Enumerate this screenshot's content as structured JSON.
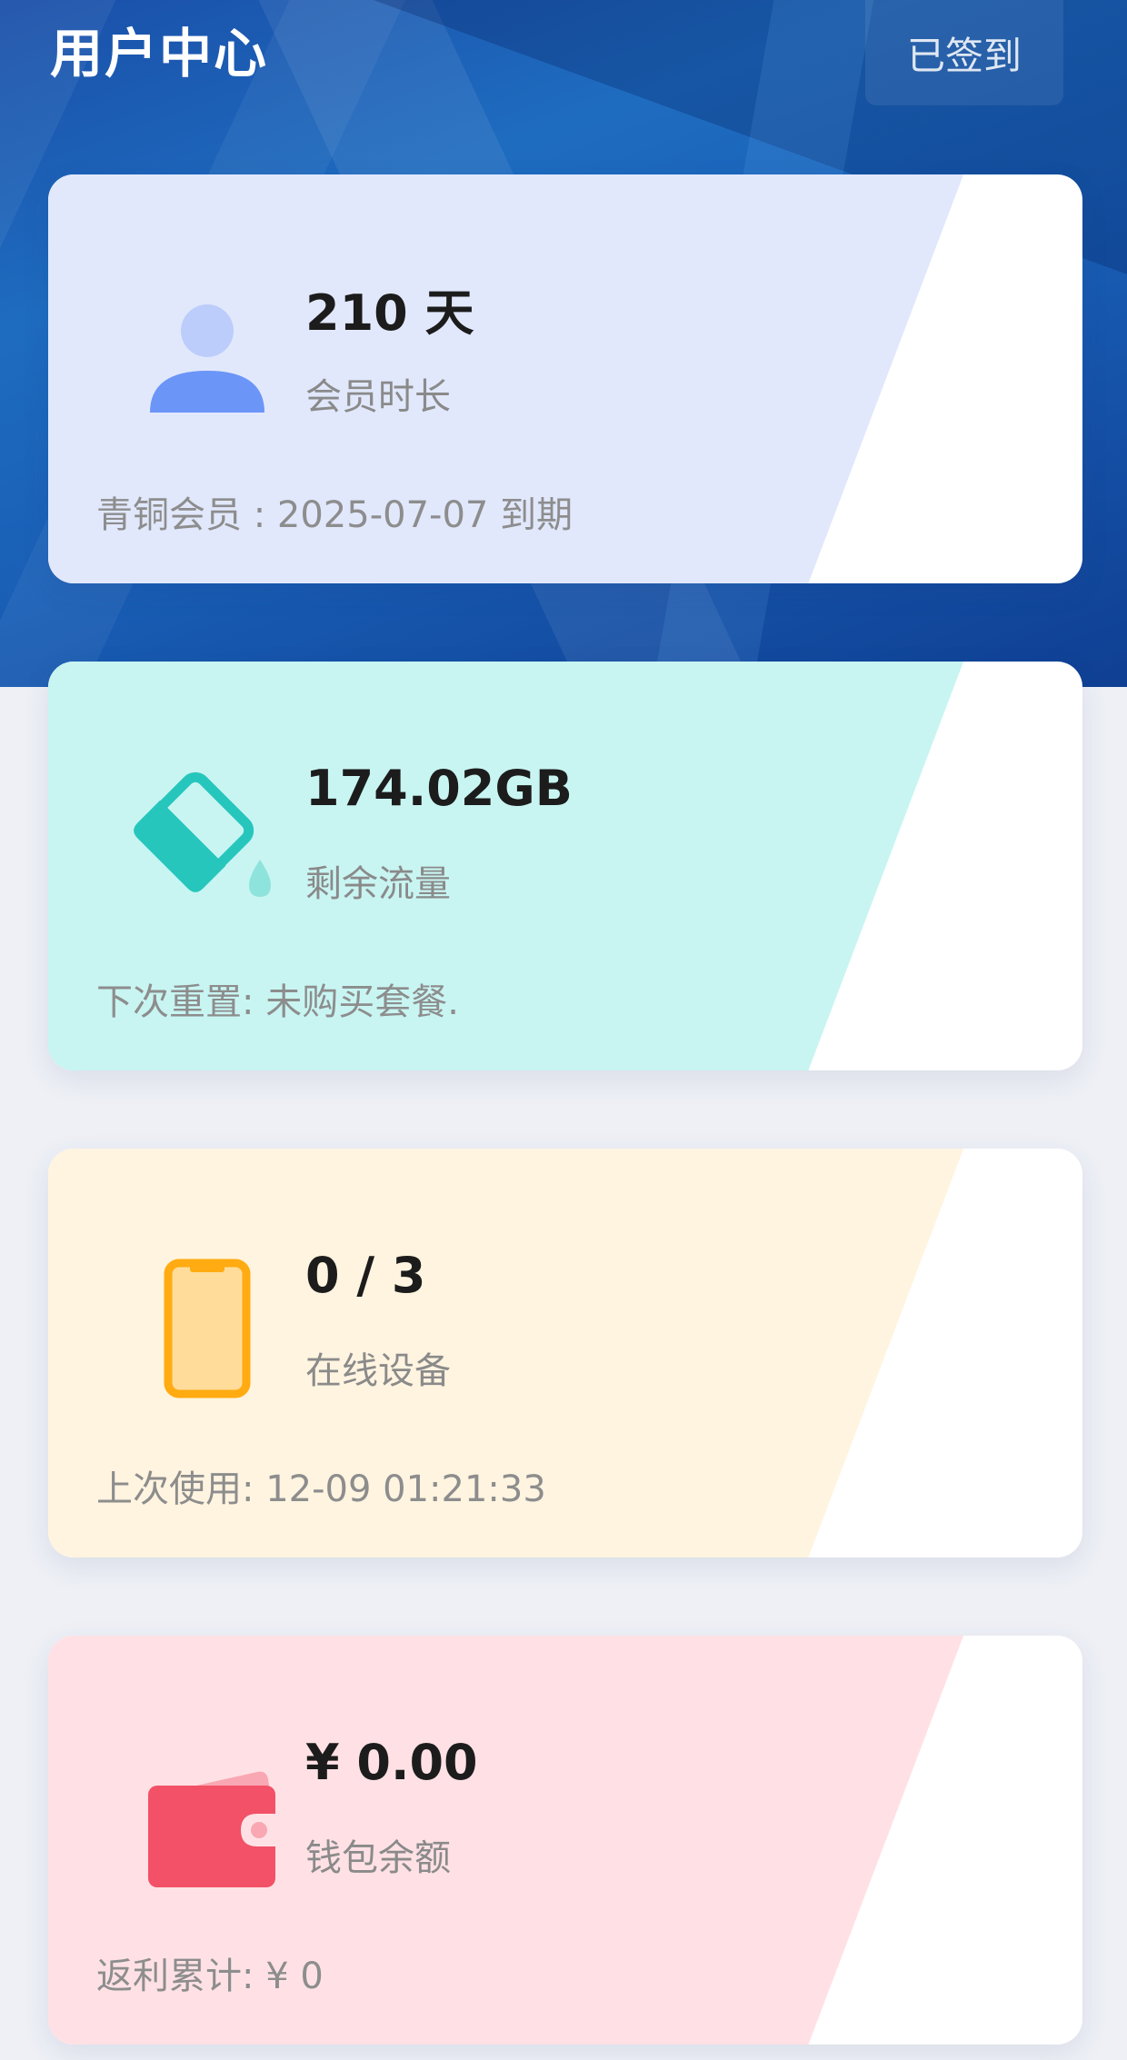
{
  "header": {
    "title": "用户中心",
    "checkin_label": "已签到"
  },
  "cards": [
    {
      "id": "membership",
      "value": "210 天",
      "label": "会员时长",
      "footer": "青铜会员 : 2025-07-07 到期",
      "icon": "user-icon",
      "bg_color": "#e1e8fc"
    },
    {
      "id": "traffic",
      "value": "174.02GB",
      "label": "剩余流量",
      "footer": "下次重置:  未购买套餐.",
      "icon": "water-bucket-icon",
      "bg_color": "#c8f5f2"
    },
    {
      "id": "devices",
      "value": "0 / 3",
      "label": "在线设备",
      "footer": "上次使用: 12-09 01:21:33",
      "icon": "phone-icon",
      "bg_color": "#fff4e0"
    },
    {
      "id": "wallet",
      "value": "¥ 0.00",
      "label": "钱包余额",
      "footer": "返利累计: ¥ 0",
      "icon": "wallet-icon",
      "bg_color": "#ffe1e5"
    }
  ]
}
